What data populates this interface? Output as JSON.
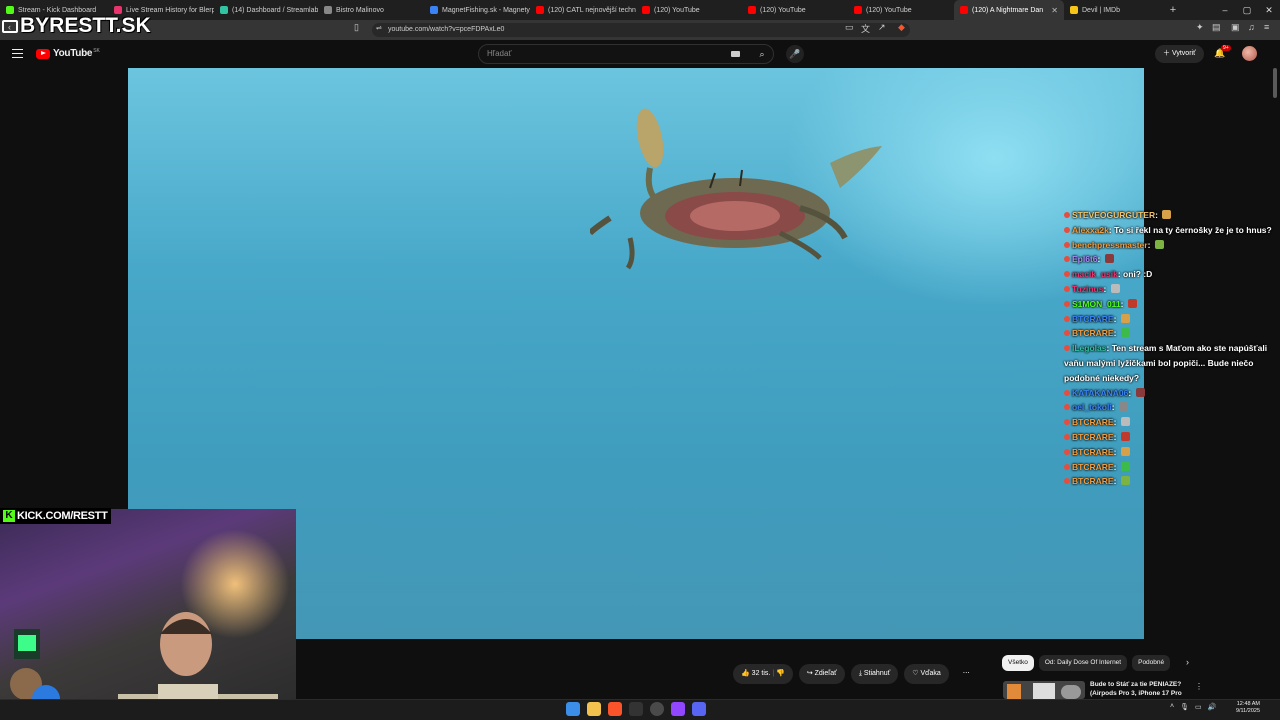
{
  "browser": {
    "tabs": [
      {
        "label": "Stream - Kick Dashboard",
        "color": "#53fc18"
      },
      {
        "label": "Live Stream History for Blerp S",
        "color": "#e8336d"
      },
      {
        "label": "(14) Dashboard / Streamlabs",
        "color": "#31c3a2"
      },
      {
        "label": "Bistro Malinovo",
        "color": "#888888"
      },
      {
        "label": "MagnetFishing.sk - Magnety a",
        "color": "#3b82f6"
      },
      {
        "label": "(120) CATL nejnovější technolo",
        "color": "#ff0000"
      },
      {
        "label": "(120) YouTube",
        "color": "#ff0000"
      },
      {
        "label": "(120) YouTube",
        "color": "#ff0000"
      },
      {
        "label": "(120) YouTube",
        "color": "#ff0000"
      },
      {
        "label": "(120) A Nightmare Dan",
        "color": "#ff0000",
        "active": true
      },
      {
        "label": "Devil | IMDb",
        "color": "#f5c518"
      }
    ],
    "new_tab": "+",
    "url": "youtube.com/watch?v=pceFDPAxLe0"
  },
  "overlay": {
    "banner": "BYRESTT.SK",
    "kick": "KICK.COM/RESTT"
  },
  "youtube": {
    "logo": "YouTube",
    "country": "SK",
    "search_placeholder": "Hľadať",
    "create_label": "Vytvoriť",
    "notif_badge": "9+"
  },
  "chat": [
    {
      "user": "STEVEOGURGUTER",
      "color": "#f3c36b",
      "msg": ""
    },
    {
      "user": "Alexxa2k",
      "color": "#f39c3d",
      "msg": "To si řekl na ty černošky že je to hnus?"
    },
    {
      "user": "benchpressmaster",
      "color": "#f39c3d",
      "msg": ""
    },
    {
      "user": "Epl6t6",
      "color": "#a78bfa",
      "msg": ""
    },
    {
      "user": "macik_usik",
      "color": "#e8336d",
      "msg": "oni? :D"
    },
    {
      "user": "Tuzinus",
      "color": "#e8336d",
      "msg": ""
    },
    {
      "user": "S1MON_011",
      "color": "#53fc18",
      "msg": ""
    },
    {
      "user": "BTCRARE",
      "color": "#3b82f6",
      "msg": ""
    },
    {
      "user": "BTCRARE",
      "color": "#f39c3d",
      "msg": ""
    },
    {
      "user": "ILegolas",
      "color": "#31c3a2",
      "msg": "Ten stream s Maťom ako ste napúšťali vaňu malými lyžičkami bol popiči... Bude niečo podobné niekedy?"
    },
    {
      "user": "KATAKANA06",
      "color": "#3b82f6",
      "msg": ""
    },
    {
      "user": "oel_tokoli",
      "color": "#3b82f6",
      "msg": ""
    },
    {
      "user": "BTCRARE",
      "color": "#f39c3d",
      "msg": ""
    },
    {
      "user": "BTCRARE",
      "color": "#f39c3d",
      "msg": ""
    },
    {
      "user": "BTCRARE",
      "color": "#f39c3d",
      "msg": ""
    },
    {
      "user": "BTCRARE",
      "color": "#f39c3d",
      "msg": ""
    },
    {
      "user": "BTCRARE",
      "color": "#f39c3d",
      "msg": ""
    }
  ],
  "actions": {
    "likes": "32 tis.",
    "share": "Zdieľať",
    "download": "Stiahnuť",
    "thanks": "Vďaka",
    "more": "⋯"
  },
  "chips": [
    "Všetko",
    "Od: Daily Dose Of Internet",
    "Podobné"
  ],
  "recommendation": {
    "title": "Bude to Stáť za tie PENIAZE? (Airpods Pro 3, iPhone 17 Pro"
  },
  "clock": {
    "time": "12:48 AM",
    "date": "9/11/2025"
  }
}
